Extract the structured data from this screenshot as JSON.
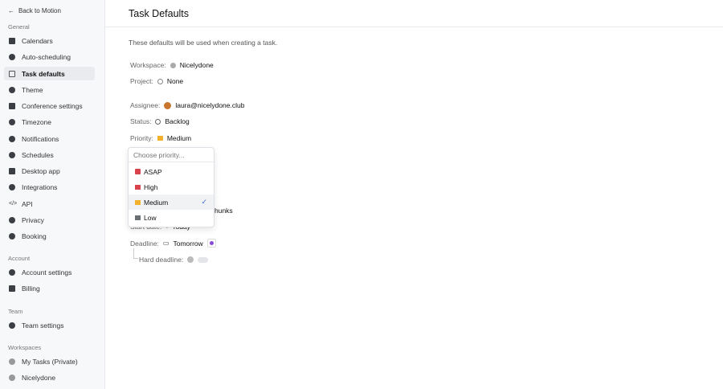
{
  "sidebar": {
    "back": "Back to Motion",
    "sections": {
      "general": "General",
      "account": "Account",
      "team": "Team",
      "workspaces": "Workspaces"
    },
    "general": [
      "Calendars",
      "Auto-scheduling",
      "Task defaults",
      "Theme",
      "Conference settings",
      "Timezone",
      "Notifications",
      "Schedules",
      "Desktop app",
      "Integrations",
      "API",
      "Privacy",
      "Booking"
    ],
    "account": [
      "Account settings",
      "Billing"
    ],
    "team": [
      "Team settings"
    ],
    "workspaces": [
      "My Tasks (Private)",
      "Nicelydone"
    ]
  },
  "main": {
    "title": "Task Defaults",
    "description": "These defaults will be used when creating a task.",
    "workspace": {
      "label": "Workspace:",
      "value": "Nicelydone"
    },
    "project": {
      "label": "Project:",
      "value": "None"
    },
    "assignee": {
      "label": "Assignee:",
      "value": "laura@nicelydone.club"
    },
    "status": {
      "label": "Status:",
      "value": "Backlog"
    },
    "priority": {
      "label": "Priority:",
      "value": "Medium"
    },
    "chunks_fragment": "hunks",
    "start_date": {
      "label": "Start date:",
      "value": "Today"
    },
    "deadline": {
      "label": "Deadline:",
      "value": "Tomorrow"
    },
    "hard_deadline": {
      "label": "Hard deadline:",
      "enabled": false
    }
  },
  "dropdown": {
    "placeholder": "Choose priority...",
    "options": [
      {
        "label": "ASAP",
        "color": "#d9434e"
      },
      {
        "label": "High",
        "color": "#d9434e"
      },
      {
        "label": "Medium",
        "color": "#f2b12a",
        "selected": true
      },
      {
        "label": "Low",
        "color": "#6b7075"
      }
    ],
    "check": "✓"
  }
}
